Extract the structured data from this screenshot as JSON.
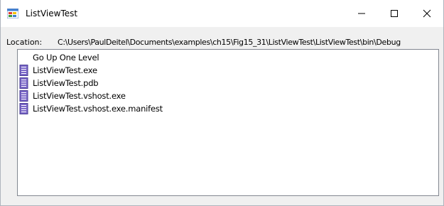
{
  "window": {
    "title": "ListViewTest",
    "app_icon": "winforms-app-icon",
    "minimize_icon": "minimize-icon",
    "maximize_icon": "maximize-icon",
    "close_icon": "close-icon"
  },
  "location": {
    "label": "Location:",
    "path": "C:\\Users\\PaulDeitel\\Documents\\examples\\ch15\\Fig15_31\\ListViewTest\\ListViewTest\\bin\\Debug"
  },
  "listview": {
    "items": [
      {
        "label": "Go Up One Level",
        "icon": "none"
      },
      {
        "label": "ListViewTest.exe",
        "icon": "file-icon"
      },
      {
        "label": "ListViewTest.pdb",
        "icon": "file-icon"
      },
      {
        "label": "ListViewTest.vshost.exe",
        "icon": "file-icon"
      },
      {
        "label": "ListViewTest.vshost.exe.manifest",
        "icon": "file-icon"
      }
    ]
  },
  "colors": {
    "file_icon_fill": "#7b68c8",
    "file_icon_lines": "#ffffff",
    "window_bg": "#f0f0f0",
    "list_border": "#828790"
  }
}
